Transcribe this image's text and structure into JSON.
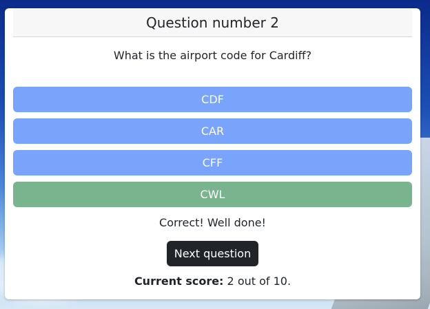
{
  "quiz": {
    "header": "Question number 2",
    "question": "What is the airport code for Cardiff?",
    "answers": [
      {
        "label": "CDF",
        "state": "default"
      },
      {
        "label": "CAR",
        "state": "default"
      },
      {
        "label": "CFF",
        "state": "default"
      },
      {
        "label": "CWL",
        "state": "correct"
      }
    ],
    "feedback": "Correct! Well done!",
    "next_label": "Next question",
    "score_label": "Current score:",
    "score_value": "2 out of 10."
  },
  "colors": {
    "answer_default": "#7aa3fc",
    "answer_correct": "#79b48f",
    "next_button": "#212529"
  }
}
